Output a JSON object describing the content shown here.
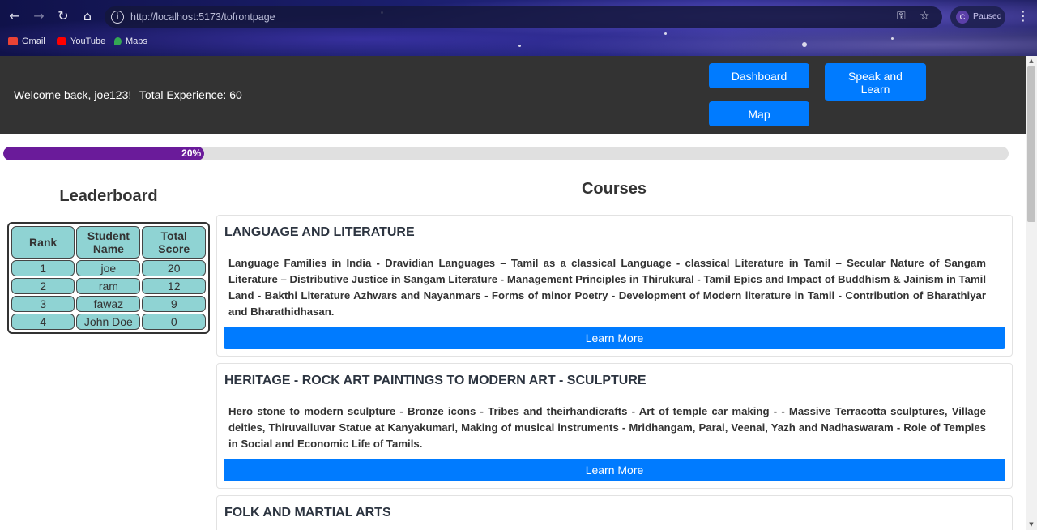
{
  "browser": {
    "url": "http://localhost:5173/tofrontpage",
    "profile_initial": "C",
    "profile_status": "Paused",
    "bookmarks": [
      {
        "label": "Gmail",
        "icon": "gmail-icon",
        "color": "#ea4335"
      },
      {
        "label": "YouTube",
        "icon": "youtube-icon",
        "color": "#ff0000"
      },
      {
        "label": "Maps",
        "icon": "maps-icon",
        "color": "#34a853"
      }
    ]
  },
  "header": {
    "welcome": "Welcome back, joe123!",
    "experience": "Total Experience: 60",
    "buttons": {
      "dashboard": "Dashboard",
      "speak_and_learn": "Speak and Learn",
      "map": "Map"
    },
    "background": "#333333",
    "button_color": "#007bff"
  },
  "progress": {
    "value": 0.2,
    "label": "20%",
    "color": "#6a1b9a"
  },
  "leaderboard": {
    "title": "Leaderboard",
    "columns": [
      "Rank",
      "Student Name",
      "Total Score"
    ],
    "rows": [
      {
        "rank": "1",
        "name": "joe",
        "score": "20"
      },
      {
        "rank": "2",
        "name": "ram",
        "score": "12"
      },
      {
        "rank": "3",
        "name": "fawaz",
        "score": "9"
      },
      {
        "rank": "4",
        "name": "John Doe",
        "score": "0"
      }
    ],
    "cell_color": "#8fd3d3"
  },
  "courses": {
    "title": "Courses",
    "items": [
      {
        "title": "LANGUAGE AND LITERATURE",
        "description": "Language Families in India - Dravidian Languages – Tamil as a classical Language - classical Literature in Tamil – Secular Nature of Sangam Literature – Distributive Justice in Sangam Literature - Management Principles in Thirukural - Tamil Epics and Impact of Buddhism & Jainism in Tamil Land - Bakthi Literature Azhwars and Nayanmars - Forms of minor Poetry - Development of Modern literature in Tamil - Contribution of Bharathiyar and Bharathidhasan.",
        "button": "Learn More"
      },
      {
        "title": "HERITAGE - ROCK ART PAINTINGS TO MODERN ART - SCULPTURE",
        "description": "Hero stone to modern sculpture - Bronze icons - Tribes and theirhandicrafts - Art of temple car making - - Massive Terracotta sculptures, Village deities, Thiruvalluvar Statue at Kanyakumari, Making of musical instruments - Mridhangam, Parai, Veenai, Yazh and Nadhaswaram - Role of Temples in Social and Economic Life of Tamils.",
        "button": "Learn More"
      },
      {
        "title": "FOLK AND MARTIAL ARTS",
        "description": "",
        "button": ""
      }
    ]
  }
}
